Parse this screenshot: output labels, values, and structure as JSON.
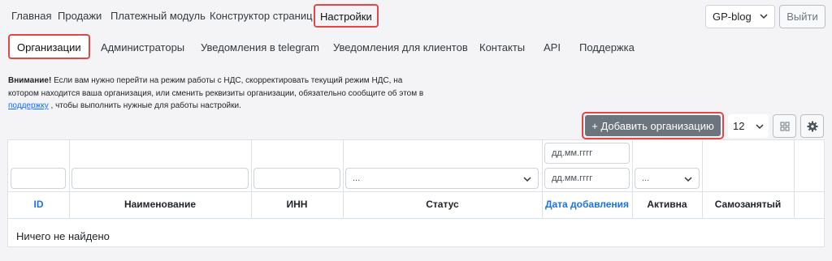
{
  "topnav": {
    "items": [
      {
        "label": "Главная"
      },
      {
        "label": "Продажи"
      },
      {
        "label": "Платежный модуль"
      },
      {
        "label": "Конструктор страниц"
      },
      {
        "label": "Настройки"
      }
    ],
    "site_select": {
      "value": "GP-blog"
    },
    "logout_label": "Выйти"
  },
  "subnav": {
    "items": [
      {
        "label": "Организации"
      },
      {
        "label": "Администраторы"
      },
      {
        "label": "Уведомления в telegram"
      },
      {
        "label": "Уведомления для клиентов"
      },
      {
        "label": "Контакты"
      },
      {
        "label": "API"
      },
      {
        "label": "Поддержка"
      }
    ]
  },
  "notice": {
    "strong": "Внимание!",
    "text_before": " Если вам нужно перейти на режим работы с НДС, скорректировать текущий режим НДС, на котором находится ваша организация, или сменить реквизиты организации, обязательно сообщите об этом в ",
    "link": "поддержку",
    "text_after": " , чтобы выполнить нужные для работы настройки."
  },
  "toolbar": {
    "add_button": "+ Добавить организацию",
    "page_size": "12",
    "columns_icon": "grid-icon",
    "settings_icon": "gear-icon"
  },
  "table": {
    "filters": {
      "status_placeholder": "...",
      "date_from_placeholder": "дд.мм.гггг",
      "date_to_placeholder": "дд.мм.гггг",
      "active_placeholder": "..."
    },
    "columns": [
      {
        "label": "ID",
        "sortable": true
      },
      {
        "label": "Наименование",
        "sortable": false
      },
      {
        "label": "ИНН",
        "sortable": false
      },
      {
        "label": "Статус",
        "sortable": false
      },
      {
        "label": "Дата добавления",
        "sortable": true
      },
      {
        "label": "Активна",
        "sortable": false
      },
      {
        "label": "Самозанятый",
        "sortable": false
      }
    ],
    "empty_text": "Ничего не найдено"
  },
  "colors": {
    "accent": "#1a73e8",
    "highlight": "#e04848",
    "button": "#6c757d"
  }
}
